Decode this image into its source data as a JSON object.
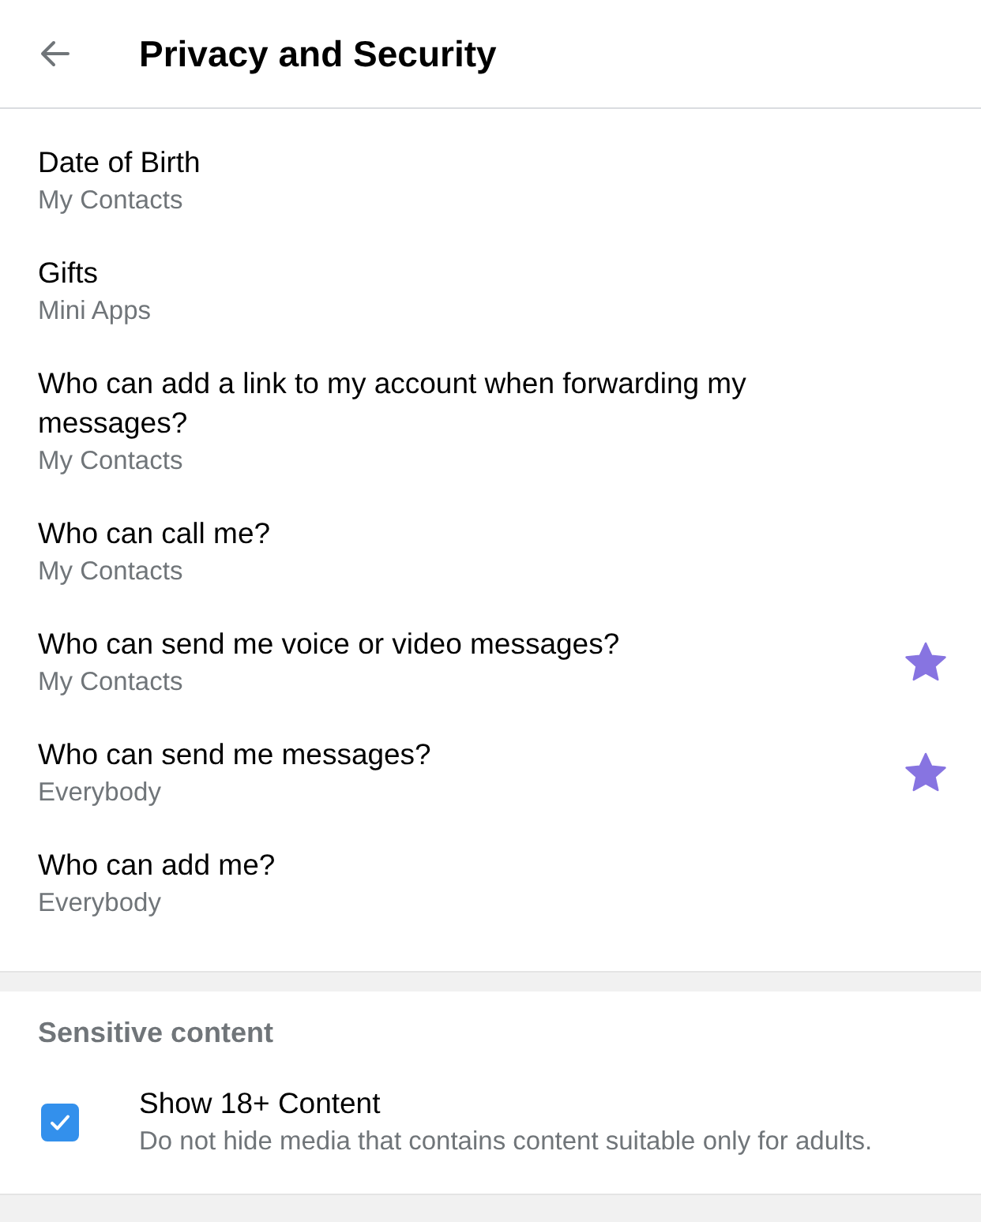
{
  "header": {
    "title": "Privacy and Security"
  },
  "privacy_items": [
    {
      "title": "Date of Birth",
      "value": "My Contacts",
      "premium": false
    },
    {
      "title": "Gifts",
      "value": "Mini Apps",
      "premium": false
    },
    {
      "title": "Who can add a link to my account when forwarding my messages?",
      "value": "My Contacts",
      "premium": false
    },
    {
      "title": "Who can call me?",
      "value": "My Contacts",
      "premium": false
    },
    {
      "title": "Who can send me voice or video messages?",
      "value": "My Contacts",
      "premium": true
    },
    {
      "title": "Who can send me messages?",
      "value": "Everybody",
      "premium": true
    },
    {
      "title": "Who can add me?",
      "value": "Everybody",
      "premium": false
    }
  ],
  "sensitive_section": {
    "heading": "Sensitive content",
    "option": {
      "title": "Show 18+ Content",
      "description": "Do not hide media that contains content suitable only for adults.",
      "checked": true
    }
  }
}
